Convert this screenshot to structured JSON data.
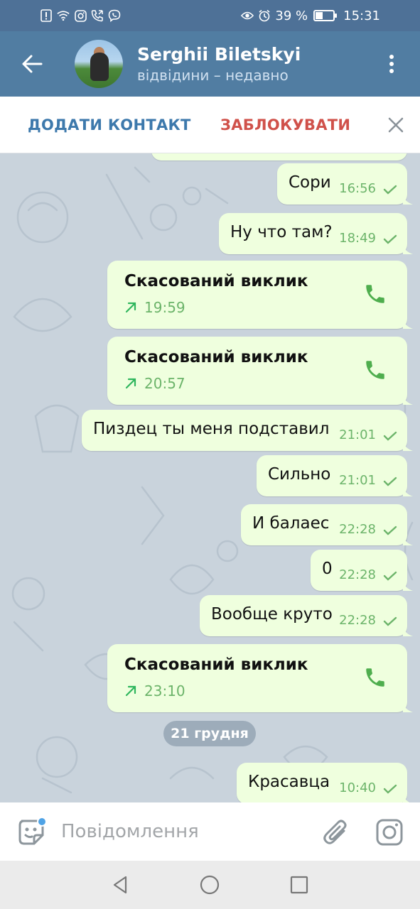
{
  "status_bar": {
    "battery_percent": "39 %",
    "battery_level": 0.39,
    "time": "15:31",
    "icons_left": [
      "alert-icon",
      "wifi-icon",
      "instagram-icon",
      "call-icon",
      "viber-icon"
    ],
    "icons_right": [
      "eye-icon",
      "alarm-icon",
      "battery-icon"
    ]
  },
  "header": {
    "name": "Serghii Biletskyi",
    "status": "відвідини – недавно"
  },
  "action_bar": {
    "add_contact": "ДОДАТИ КОНТАКТ",
    "block": "ЗАБЛОКУВАТИ"
  },
  "messages": [
    {
      "type": "text",
      "text": "Сори",
      "time": "16:56"
    },
    {
      "type": "text",
      "text": "Ну что там?",
      "time": "18:49"
    },
    {
      "type": "call",
      "title": "Скасований виклик",
      "time": "19:59"
    },
    {
      "type": "call",
      "title": "Скасований виклик",
      "time": "20:57"
    },
    {
      "type": "text",
      "text": "Пиздец ты меня подставил",
      "time": "21:01"
    },
    {
      "type": "text",
      "text": "Сильно",
      "time": "21:01"
    },
    {
      "type": "text",
      "text": "И балаес",
      "time": "22:28"
    },
    {
      "type": "text",
      "text": "0",
      "time": "22:28"
    },
    {
      "type": "text",
      "text": "Вообще круто",
      "time": "22:28"
    },
    {
      "type": "call",
      "title": "Скасований виклик",
      "time": "23:10"
    },
    {
      "type": "text",
      "text": "Красавца",
      "time": "10:40"
    }
  ],
  "date_chip": "21 грудня",
  "input": {
    "placeholder": "Повідомлення"
  },
  "colors": {
    "header": "#517da2",
    "status_bar": "#4e7197",
    "bubble_out": "#efffde",
    "time_green": "#6cb46a",
    "block_red": "#d0514a",
    "add_blue": "#3d79ac",
    "chat_bg": "#c9d3dc"
  }
}
